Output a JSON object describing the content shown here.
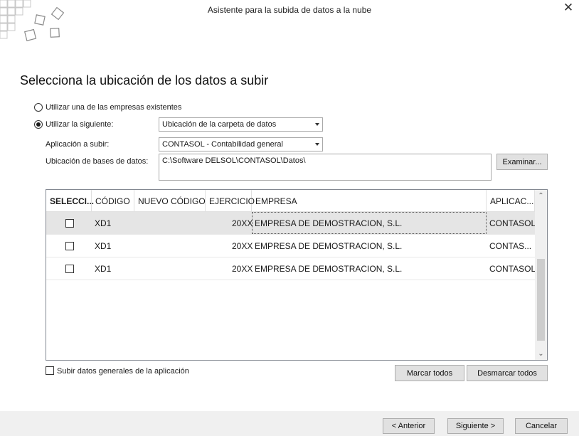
{
  "window": {
    "title": "Asistente para la subida de datos a la nube",
    "close_glyph": "✕"
  },
  "heading": "Selecciona la ubicación de los datos a subir",
  "options": {
    "existing_label": "Utilizar una de las empresas existentes",
    "following_label": "Utilizar la siguiente:",
    "selected": "following",
    "location_type": "Ubicación de la carpeta de datos",
    "app_label": "Aplicación a subir:",
    "app_value": "CONTASOL - Contabilidad general",
    "db_label": "Ubicación de bases de datos:",
    "db_value": "C:\\Software DELSOL\\CONTASOL\\Datos\\",
    "browse_label": "Examinar..."
  },
  "table": {
    "columns": [
      "SELECCI...",
      "CÓDIGO",
      "NUEVO CÓDIGO",
      "EJERCICIO",
      "EMPRESA",
      "APLICAC..."
    ],
    "rows": [
      {
        "selected": false,
        "codigo": "XD1",
        "nuevo": "",
        "ejercicio": "20XX",
        "empresa": "EMPRESA DE DEMOSTRACION, S.L.",
        "aplicacion": "CONTASOL"
      },
      {
        "selected": false,
        "codigo": "XD1",
        "nuevo": "",
        "ejercicio": "20XX",
        "empresa": "EMPRESA DE DEMOSTRACION, S.L.",
        "aplicacion": "CONTAS..."
      },
      {
        "selected": false,
        "codigo": "XD1",
        "nuevo": "",
        "ejercicio": "20XX",
        "empresa": "EMPRESA DE DEMOSTRACION, S.L.",
        "aplicacion": "CONTASOL"
      }
    ],
    "highlighted_row": 0,
    "scroll_up_glyph": "⌃",
    "scroll_down_glyph": "⌄"
  },
  "general_data_label": "Subir datos generales de la aplicación",
  "buttons": {
    "mark_all": "Marcar todos",
    "unmark_all": "Desmarcar todos",
    "previous": "< Anterior",
    "next": "Siguiente >",
    "cancel": "Cancelar"
  }
}
